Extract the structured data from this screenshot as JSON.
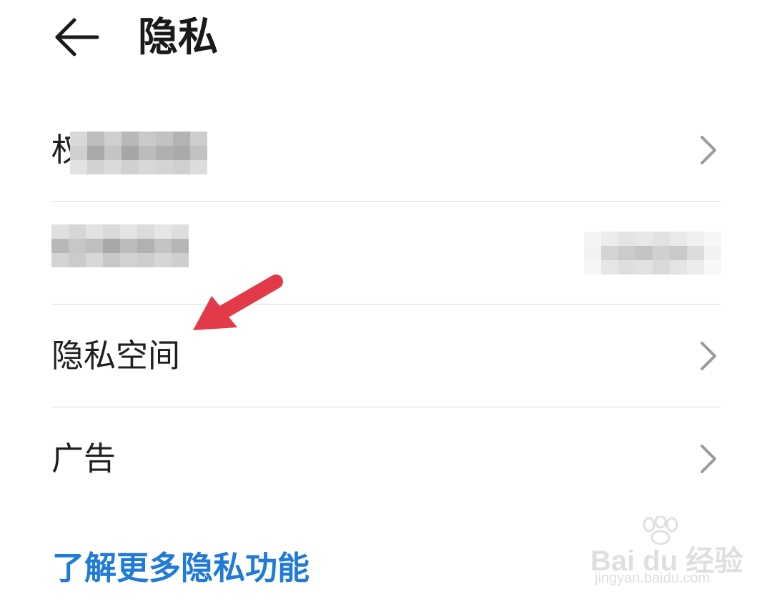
{
  "header": {
    "back_icon": "arrow-left-icon",
    "title": "隐私"
  },
  "list": {
    "items": [
      {
        "label": "权",
        "label_obscured": true,
        "value": "",
        "chevron_icon": "chevron-right-icon"
      },
      {
        "label": "",
        "label_obscured": true,
        "value": "",
        "value_obscured": true,
        "chevron_icon": "chevron-right-icon"
      },
      {
        "label": "隐私空间",
        "value": "",
        "chevron_icon": "chevron-right-icon"
      },
      {
        "label": "广告",
        "value": "",
        "chevron_icon": "chevron-right-icon"
      }
    ]
  },
  "footer": {
    "learn_more_link": "了解更多隐私功能"
  },
  "annotation": {
    "arrow_color": "#e23a48",
    "points_to": "隐私空间"
  },
  "watermark": {
    "brand": "Bai du 经验",
    "url": "jingyan.baidu.com"
  },
  "colors": {
    "accent_link": "#1f7ad8",
    "divider": "#dcdcdc",
    "text_primary": "#1f1f1f",
    "chevron": "#9a9a9a"
  }
}
